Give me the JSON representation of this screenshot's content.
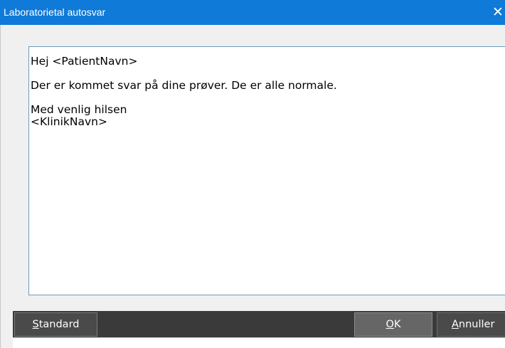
{
  "window": {
    "title": "Laboratorietal autosvar",
    "close_glyph": "✕"
  },
  "editor": {
    "content": "Hej <PatientNavn>\n\nDer er kommet svar på dine prøver. De er alle normale.\n\nMed venlig hilsen\n<KlinikNavn>"
  },
  "buttons": {
    "standard": {
      "mnemonic": "S",
      "rest": "tandard"
    },
    "ok": {
      "mnemonic": "O",
      "rest": "K"
    },
    "cancel": {
      "mnemonic": "A",
      "rest": "nnuller"
    }
  },
  "colors": {
    "titlebar": "#0f7ad8",
    "button_bar": "#3a3a3a",
    "button": "#4a4a4a",
    "button_default": "#666666",
    "editor_border": "#6d9bbd"
  },
  "icons": {
    "close": "close-icon"
  }
}
